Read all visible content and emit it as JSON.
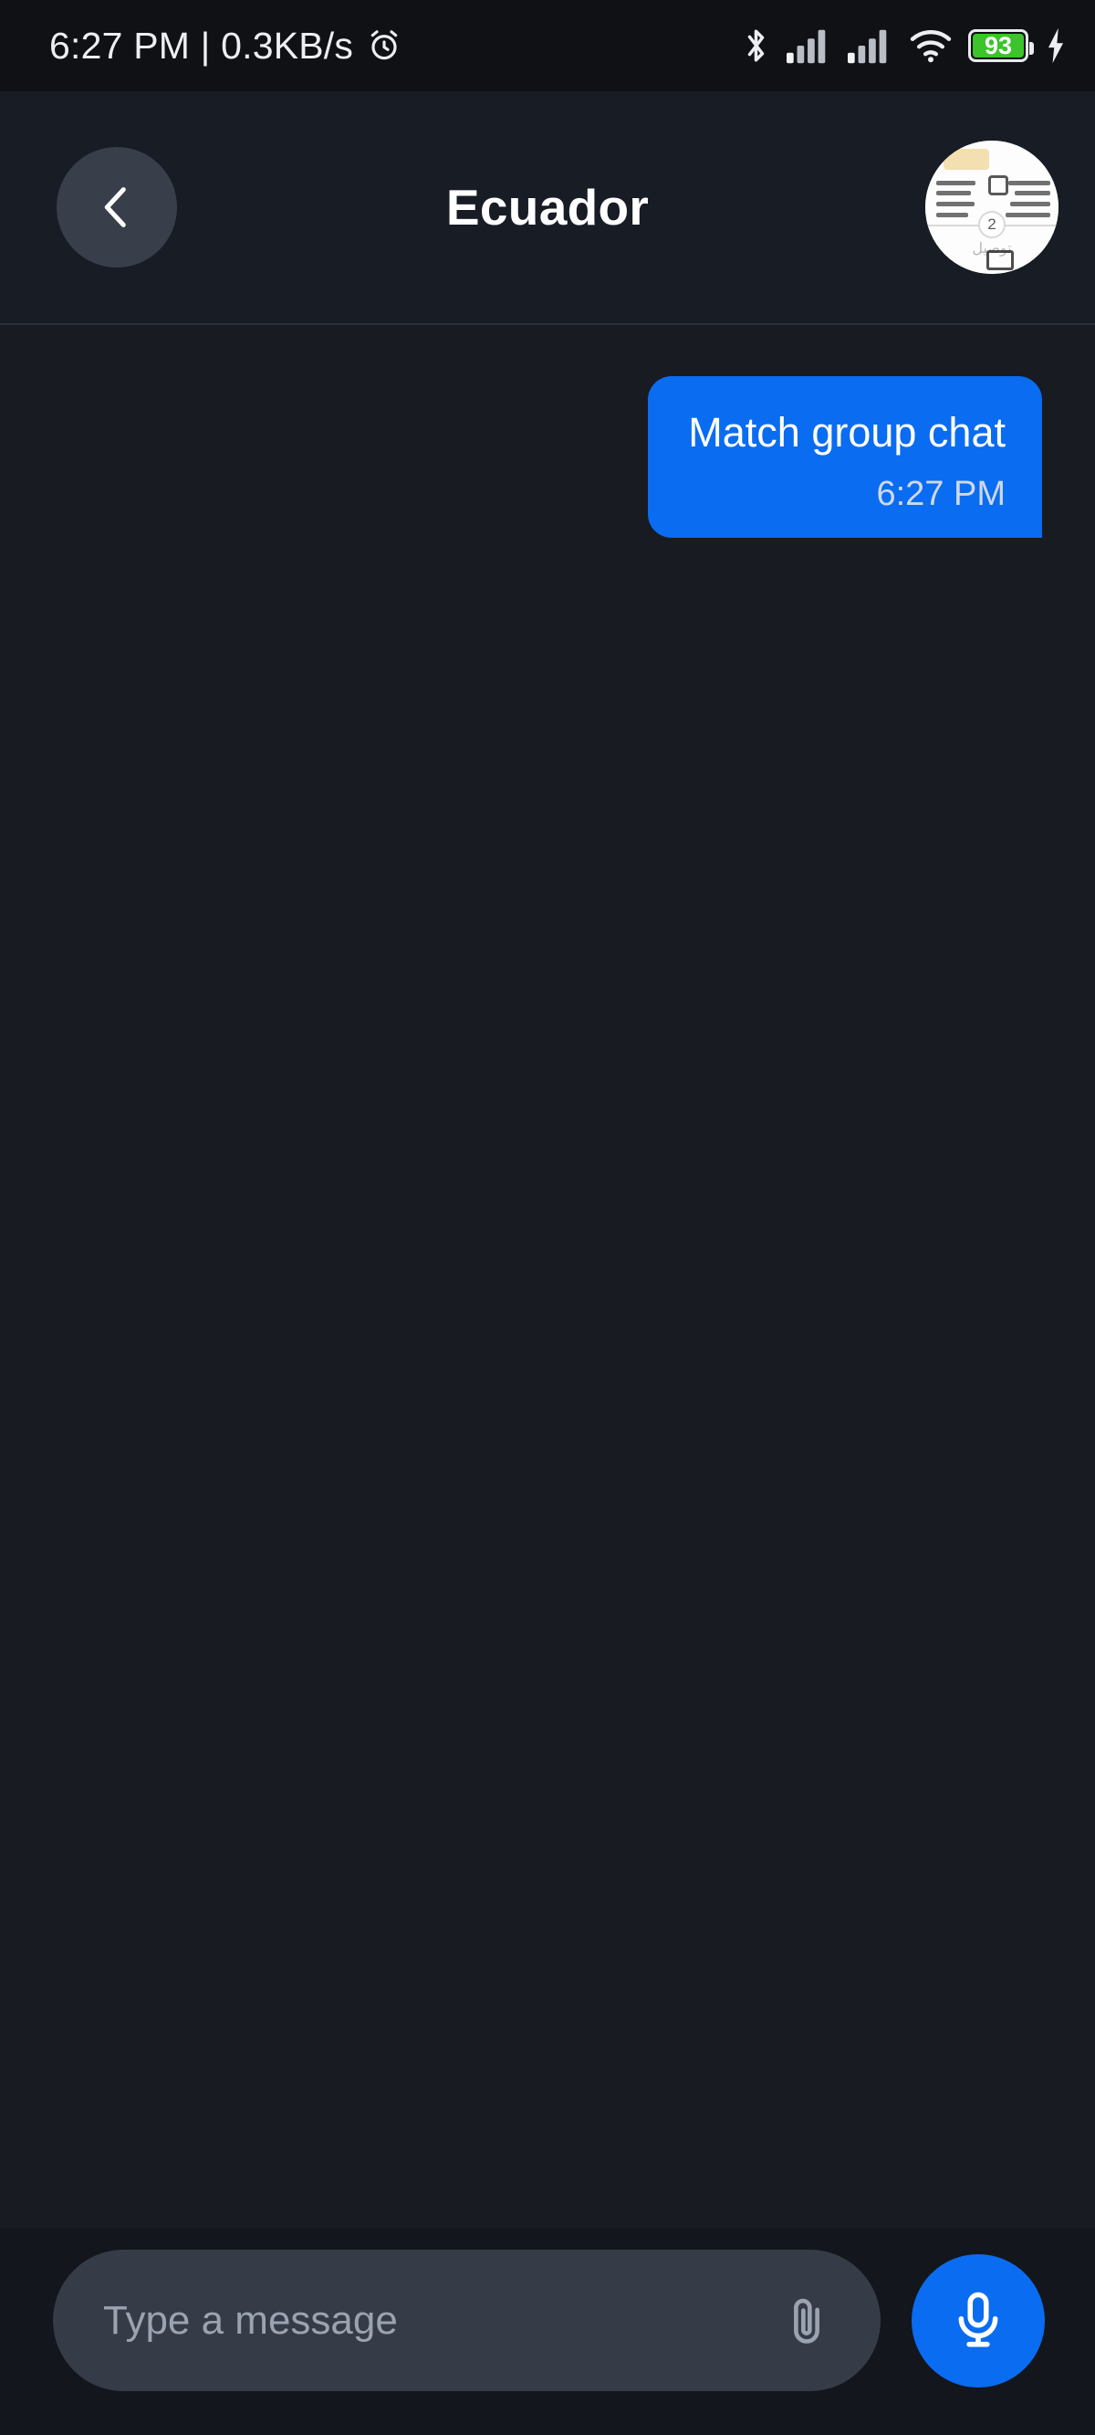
{
  "status_bar": {
    "time_and_speed": "6:27 PM | 0.3KB/s",
    "alarm_icon": "alarm-clock-icon",
    "bluetooth_icon": "bluetooth-icon",
    "signal_icon_1": "cellular-signal-icon",
    "signal_icon_2": "cellular-signal-icon",
    "wifi_icon": "wifi-icon",
    "battery_level": "93",
    "battery_icon": "battery-icon",
    "charging_icon": "charging-bolt-icon"
  },
  "header": {
    "back_icon": "chevron-left-icon",
    "title": "Ecuador",
    "avatar_name": "group-avatar",
    "avatar_badge": "2",
    "avatar_sub": "توصيل"
  },
  "chat": {
    "messages": [
      {
        "text": "Match group chat",
        "time": "6:27 PM",
        "direction": "outgoing"
      }
    ]
  },
  "input_bar": {
    "placeholder": "Type a message",
    "value": "",
    "attach_icon": "paperclip-icon",
    "mic_icon": "microphone-icon"
  },
  "colors": {
    "accent": "#0a6cf1",
    "screen_bg": "#181b22",
    "header_bg": "#181c24",
    "status_bg": "#0f1115",
    "input_bg": "#353b47",
    "battery_green": "#3bc42b"
  }
}
